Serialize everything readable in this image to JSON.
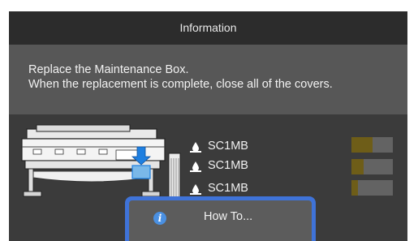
{
  "header": {
    "title": "Information"
  },
  "message": {
    "line1": "Replace the Maintenance Box.",
    "line2": "When the replacement is complete, close all of the covers."
  },
  "maintenance_boxes": [
    {
      "name": "SC1MB",
      "level": 0.5
    },
    {
      "name": "SC1MB",
      "level": 0.3
    },
    {
      "name": "SC1MB",
      "level": 0.15
    }
  ],
  "button": {
    "label": "How To...",
    "icon": "info-icon"
  },
  "colors": {
    "accent": "#3f73d8",
    "gauge_fill": "#6e5d18",
    "alert_arrow": "#1e7fe0"
  }
}
